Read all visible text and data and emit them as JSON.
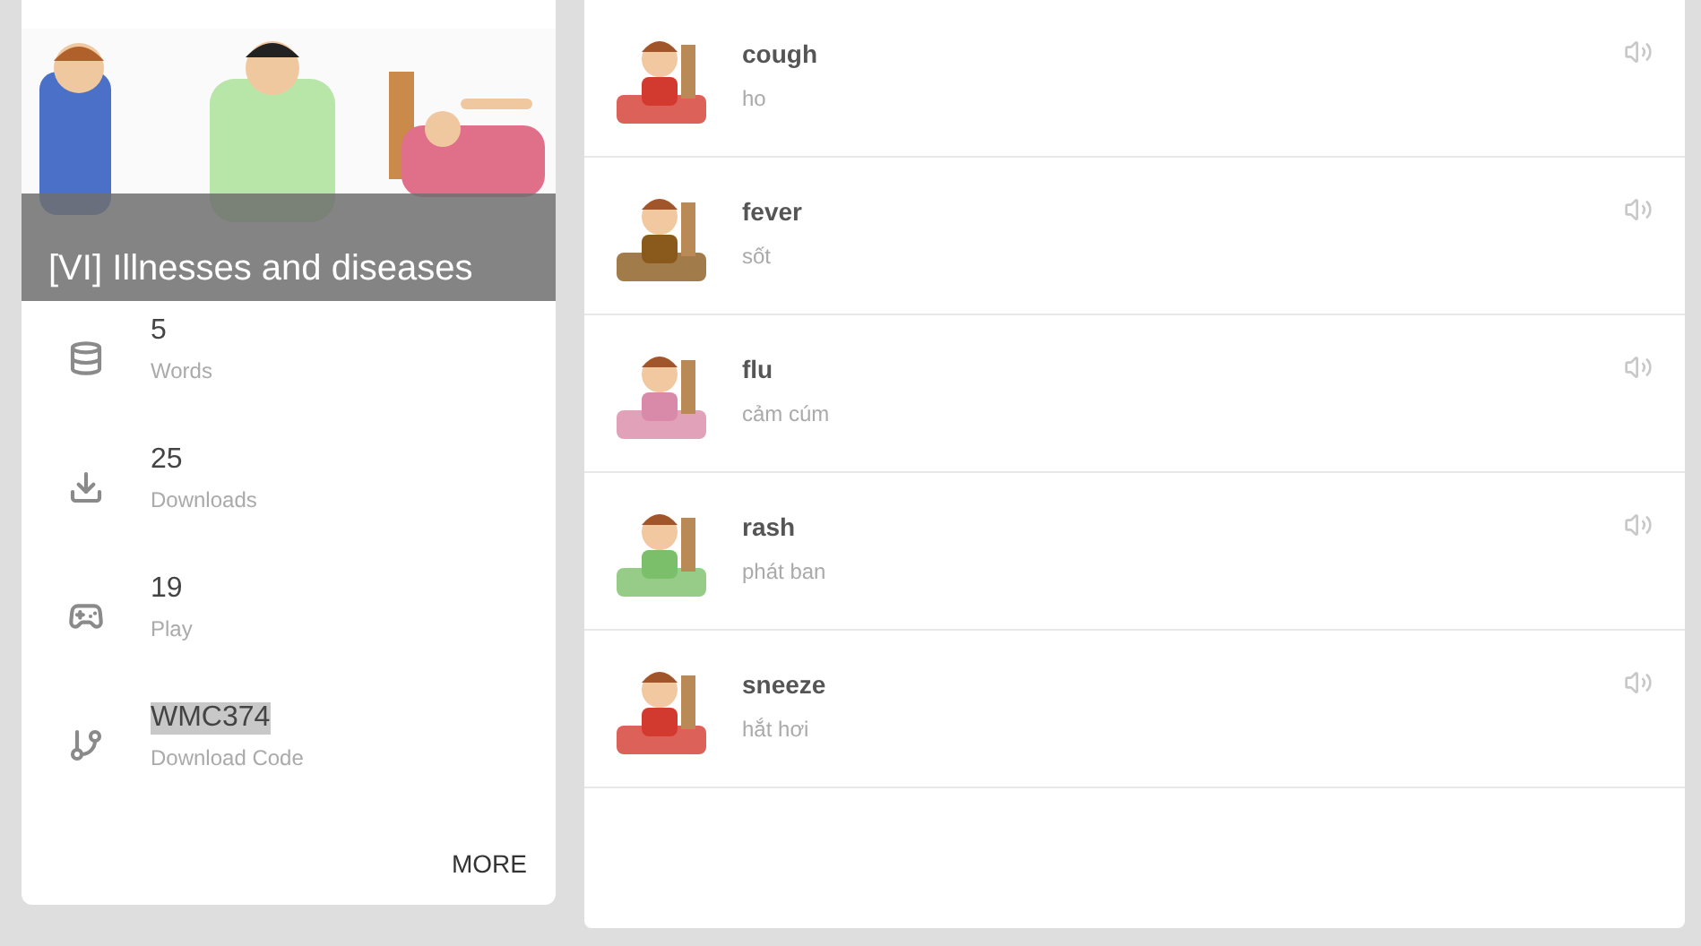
{
  "set": {
    "title": "[VI] Illnesses and diseases",
    "stats": [
      {
        "value": "5",
        "label": "Words",
        "highlighted": false
      },
      {
        "value": "25",
        "label": "Downloads",
        "highlighted": false
      },
      {
        "value": "19",
        "label": "Play",
        "highlighted": false
      },
      {
        "value": "WMC374",
        "label": "Download Code",
        "highlighted": true
      }
    ],
    "more": "MORE"
  },
  "words": [
    {
      "word": "cough",
      "meaning": "ho"
    },
    {
      "word": "fever",
      "meaning": "sốt"
    },
    {
      "word": "flu",
      "meaning": "cảm cúm"
    },
    {
      "word": "rash",
      "meaning": "phát ban"
    },
    {
      "word": "sneeze",
      "meaning": "hắt hơi"
    }
  ]
}
